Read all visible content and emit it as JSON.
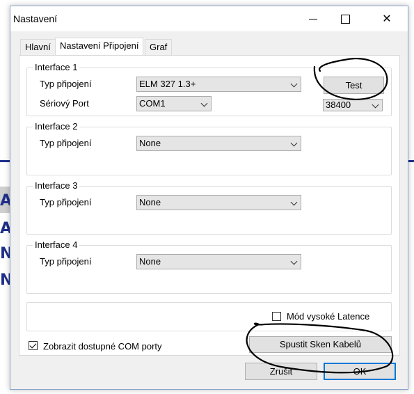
{
  "window": {
    "title": "Nastavení",
    "minimize_icon": "minimize-icon",
    "maximize_icon": "maximize-icon",
    "close_icon": "close-icon",
    "close_glyph": "✕"
  },
  "background_fragments": [
    "AF",
    "AF",
    "NI",
    "NI"
  ],
  "tabs": [
    {
      "label": "Hlavní",
      "active": false
    },
    {
      "label": "Nastavení Připojení",
      "active": true
    },
    {
      "label": "Graf",
      "active": false
    }
  ],
  "interfaces": [
    {
      "label": "Interface 1",
      "type_label": "Typ připojení",
      "type_value": "ELM 327 1.3+",
      "port_label": "Sériový Port",
      "port_value": "COM1",
      "baud_value": "38400",
      "test_label": "Test"
    },
    {
      "label": "Interface 2",
      "type_label": "Typ připojení",
      "type_value": "None"
    },
    {
      "label": "Interface 3",
      "type_label": "Typ připojení",
      "type_value": "None"
    },
    {
      "label": "Interface 4",
      "type_label": "Typ připojení",
      "type_value": "None"
    }
  ],
  "high_latency": {
    "label": "Mód vysoké Latence",
    "checked": false
  },
  "show_com_ports": {
    "label": "Zobrazit dostupné COM porty",
    "checked": true
  },
  "buttons": {
    "scan": "Spustit Sken Kabelů",
    "cancel": "Zrušit",
    "ok": "OK"
  },
  "colors": {
    "accent": "#0078d7",
    "annotation_ink": "#000000",
    "background_app_blue": "#1f2f8a"
  }
}
